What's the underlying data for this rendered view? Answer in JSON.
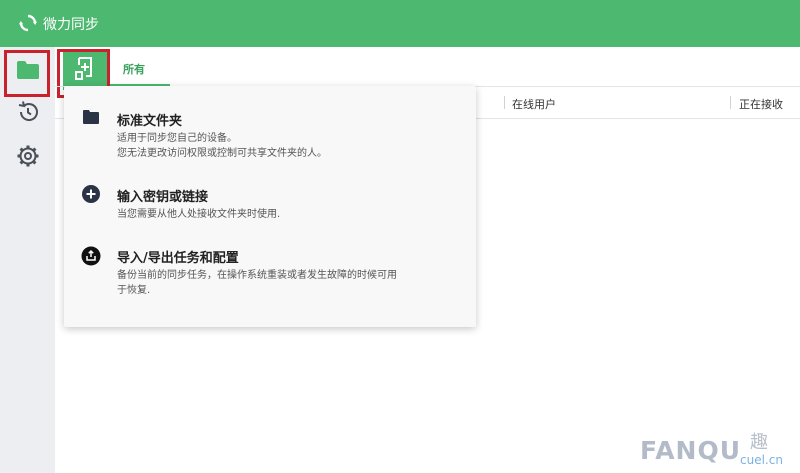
{
  "app": {
    "title": "微力同步"
  },
  "colors": {
    "brand": "#4cb870",
    "highlight": "#c8232c",
    "sidebar_bg": "#eceef1"
  },
  "sidebar": {
    "items": [
      {
        "icon": "folder-icon",
        "active": true
      },
      {
        "icon": "history-icon",
        "active": false
      },
      {
        "icon": "gear-icon",
        "active": false
      }
    ]
  },
  "toolbar": {
    "add_icon": "add-folder-icon"
  },
  "tabs": [
    {
      "label": "所有",
      "active": true
    }
  ],
  "table": {
    "columns": [
      "在线用户",
      "正在接收"
    ]
  },
  "add_menu": {
    "items": [
      {
        "icon": "folder-icon",
        "title": "标准文件夹",
        "desc": [
          "适用于同步您自己的设备。",
          "您无法更改访问权限或控制可共享文件夹的人。"
        ]
      },
      {
        "icon": "plus-circle-icon",
        "title": "输入密钥或链接",
        "desc": [
          "当您需要从他人处接收文件夹时使用."
        ]
      },
      {
        "icon": "export-icon",
        "title": "导入/导出任务和配置",
        "desc": [
          "备份当前的同步任务，在操作系统重装或者发生故障的时候可用",
          "于恢复."
        ]
      }
    ]
  },
  "watermark": {
    "text": "FANQU",
    "cn": "趣",
    "sub": "cuel.cn"
  }
}
